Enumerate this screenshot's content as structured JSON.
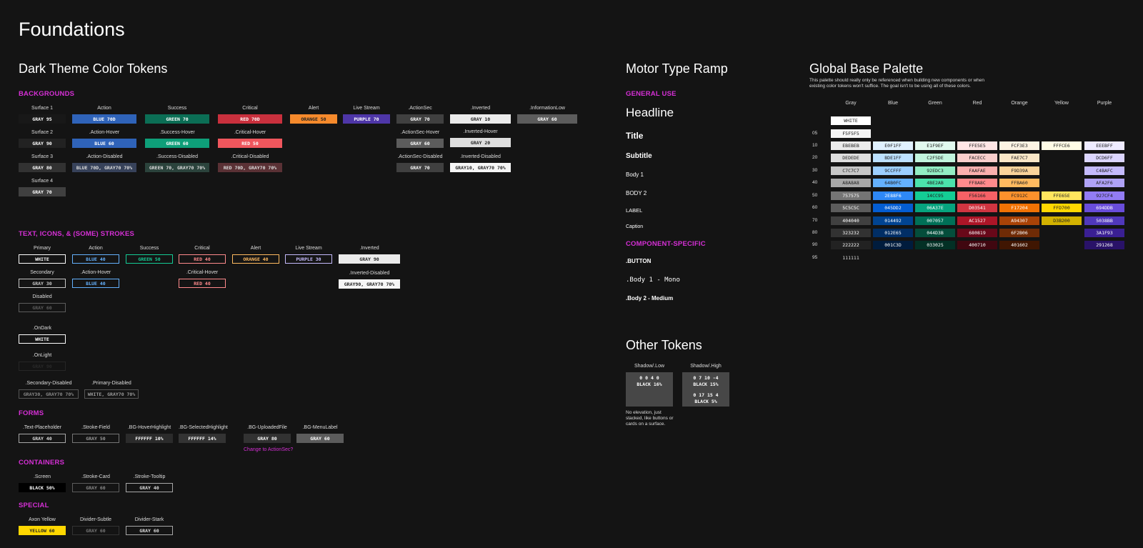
{
  "page_title": "Foundations",
  "dark_theme": {
    "title": "Dark Theme Color Tokens",
    "backgrounds": {
      "heading": "BACKGROUNDS",
      "surfaces": [
        {
          "label": "Surface 1",
          "value": "GRAY 95"
        },
        {
          "label": "Surface 2",
          "value": "GRAY 90"
        },
        {
          "label": "Surface 3",
          "value": "GRAY 80"
        },
        {
          "label": "Surface 4",
          "value": "GRAY 70"
        }
      ],
      "action": [
        {
          "label": "Action",
          "value": "BLUE 70D"
        },
        {
          "label": ".Action-Hover",
          "value": "BLUE 60"
        },
        {
          "label": ".Action-Disabled",
          "value": "BLUE 70D, GRAY70 70%"
        }
      ],
      "success": [
        {
          "label": "Success",
          "value": "GREEN 70"
        },
        {
          "label": ".Success-Hover",
          "value": "GREEN 60"
        },
        {
          "label": ".Success-Disabled",
          "value": "GREEN 70, GRAY70 70%"
        }
      ],
      "critical": [
        {
          "label": "Critical",
          "value": "RED 70D"
        },
        {
          "label": ".Critical-Hover",
          "value": "RED 50"
        },
        {
          "label": ".Critical-Disabled",
          "value": "RED 70D, GRAY70 70%"
        }
      ],
      "alert": {
        "label": "Alert",
        "value": "ORANGE 50"
      },
      "live_stream": {
        "label": "Live Stream",
        "value": "PURPLE 70"
      },
      "action_sec": [
        {
          "label": ".ActionSec",
          "value": "GRAY 70"
        },
        {
          "label": ".ActionSec-Hover",
          "value": "GRAY 60"
        },
        {
          "label": ".ActionSec-Disabled",
          "value": "GRAY 70"
        }
      ],
      "inverted": [
        {
          "label": ".Inverted",
          "value": "GRAY 10"
        },
        {
          "label": ".Inverted-Hover",
          "value": "GRAY 20"
        },
        {
          "label": ".Inverted-Disabled",
          "value": "GRAY10, GRAY70 70%"
        }
      ],
      "information_low": {
        "label": ".InformationLow",
        "value": "GRAY 60"
      }
    },
    "text": {
      "heading": "TEXT, ICONS, & (SOME) STROKES",
      "primary": {
        "label": "Primary",
        "value": "WHITE"
      },
      "secondary": {
        "label": "Secondary",
        "value": "GRAY 30"
      },
      "disabled": {
        "label": "Disabled",
        "value": "GRAY 60"
      },
      "on_dark": {
        "label": ".OnDark",
        "value": "WHITE"
      },
      "on_light": {
        "label": ".OnLight",
        "value": "GRAY 90"
      },
      "secondary_disabled": {
        "label": ".Secondary-Disabled",
        "value": "GRAY30, GRAY70 70%"
      },
      "primary_disabled": {
        "label": ".Primary-Disabled",
        "value": "WHITE, GRAY70 70%"
      },
      "action": {
        "label": "Action",
        "value": "BLUE 40"
      },
      "action_hover": {
        "label": ".Action-Hover",
        "value": "BLUE 40"
      },
      "success": {
        "label": "Success",
        "value": "GREEN 50"
      },
      "critical": {
        "label": "Critical",
        "value": "RED 40"
      },
      "critical_hover": {
        "label": ".Critical-Hover",
        "value": "RED 40"
      },
      "alert": {
        "label": "Alert",
        "value": "ORANGE 40"
      },
      "live_stream": {
        "label": "Live Stream",
        "value": "PURPLE 30"
      },
      "inverted": {
        "label": ".Inverted",
        "value": "GRAY 90"
      },
      "inverted_disabled": {
        "label": ".Inverted-Disabled",
        "value": "GRAY90, GRAY70 70%"
      }
    },
    "forms": {
      "heading": "FORMS",
      "items": [
        {
          "label": ".Text-Placeholder",
          "value": "GRAY 40"
        },
        {
          "label": ".Stroke-Field",
          "value": "GRAY 50"
        },
        {
          "label": ".BG-HoverHighlight",
          "value": "FFFFFF 10%"
        },
        {
          "label": ".BG-SelectedHighlight",
          "value": "FFFFFF 14%"
        },
        {
          "label": ".BG-UploadedFile",
          "value": "GRAY 80"
        },
        {
          "label": ".BG-MenuLabel",
          "value": "GRAY 60"
        }
      ],
      "note": "Change to ActionSec?"
    },
    "containers": {
      "heading": "CONTAINERS",
      "items": [
        {
          "label": ".Screen",
          "value": "BLACK 50%"
        },
        {
          "label": ".Stroke-Card",
          "value": "GRAY 60"
        },
        {
          "label": ".Stroke-Tooltip",
          "value": "GRAY 40"
        }
      ]
    },
    "special": {
      "heading": "SPECIAL",
      "items": [
        {
          "label": "Axon Yellow",
          "value": "YELLOW 60"
        },
        {
          "label": "Divider-Subtle",
          "value": "GRAY 60"
        },
        {
          "label": "Divider-Stark",
          "value": "GRAY 60"
        }
      ]
    }
  },
  "type_ramp": {
    "title": "Motor Type Ramp",
    "general_heading": "GENERAL USE",
    "general": [
      "Headline",
      "Title",
      "Subtitle",
      "Body 1",
      "BODY 2",
      "LABEL",
      "Caption"
    ],
    "component_heading": "COMPONENT-SPECIFIC",
    "component": [
      ".BUTTON",
      ".Body 1 - Mono",
      ".Body 2 - Medium"
    ]
  },
  "other_tokens": {
    "title": "Other Tokens",
    "low": {
      "label": "Shadow/.Low",
      "line1": "0 0 4 0",
      "line2": "BLACK 16%"
    },
    "high": {
      "label": "Shadow/.High",
      "line1": "0 7 10 -4",
      "line2": "BLACK 15%",
      "line3": "0 17 15 4",
      "line4": "BLACK 5%"
    },
    "note": "No elevation, just stacked, like buttons or cards on a surface."
  },
  "palette": {
    "title": "Global Base Palette",
    "description": "This palette should really only be referenced when building new components or when existing color tokens won't suffice. The goal isn't to be using all of these colors.",
    "columns": [
      "Gray",
      "Blue",
      "Green",
      "Red",
      "Orange",
      "Yellow",
      "Purple"
    ],
    "gray": {
      "white": "WHITE",
      "s05": "F5F5F5",
      "s95": "111111"
    },
    "row_labels": [
      "05",
      "10",
      "20",
      "30",
      "40",
      "50",
      "60",
      "70",
      "80",
      "90",
      "95"
    ],
    "rows": [
      {
        "gray": "EBEBEB",
        "blue": "E0F1FF",
        "green": "E1F9EF",
        "red": "FFE5E5",
        "orange": "FCF3E3",
        "yellow": "FFFCE6",
        "purple": "EEEBFF"
      },
      {
        "gray": "DEDEDE",
        "blue": "BDE1FF",
        "green": "C2F5DE",
        "red": "FACECC",
        "orange": "FAE7C7",
        "yellow": "",
        "purple": "DCD6FF"
      },
      {
        "gray": "C7C7C7",
        "blue": "9CCFFF",
        "green": "92EDC3",
        "red": "FAAFAE",
        "orange": "F9D39A",
        "yellow": "",
        "purple": "C4BAFC"
      },
      {
        "gray": "A8A8A8",
        "blue": "64B0FC",
        "green": "4BE2AB",
        "red": "FF8A8C",
        "orange": "FFBA60",
        "yellow": "",
        "purple": "AFA2F6"
      },
      {
        "gray": "757575",
        "blue": "2E88F6",
        "green": "14CC95",
        "red": "F56166",
        "orange": "FC912C",
        "yellow": "FFE65E",
        "purple": "927CF4"
      },
      {
        "gray": "5C5C5C",
        "blue": "045DD2",
        "green": "06A37E",
        "red": "D03541",
        "orange": "F17204",
        "yellow": "FFD700",
        "purple": "694DDB"
      },
      {
        "gray": "404040",
        "blue": "014492",
        "green": "007057",
        "red": "AC1527",
        "orange": "A94307",
        "yellow": "D3B200",
        "purple": "5038BB"
      },
      {
        "gray": "323232",
        "blue": "012E65",
        "green": "044D3B",
        "red": "680819",
        "orange": "6F2B06",
        "yellow": "",
        "purple": "3A1F93"
      },
      {
        "gray": "222222",
        "blue": "001C3D",
        "green": "033025",
        "red": "400710",
        "orange": "401602",
        "yellow": "",
        "purple": "291268"
      }
    ]
  }
}
